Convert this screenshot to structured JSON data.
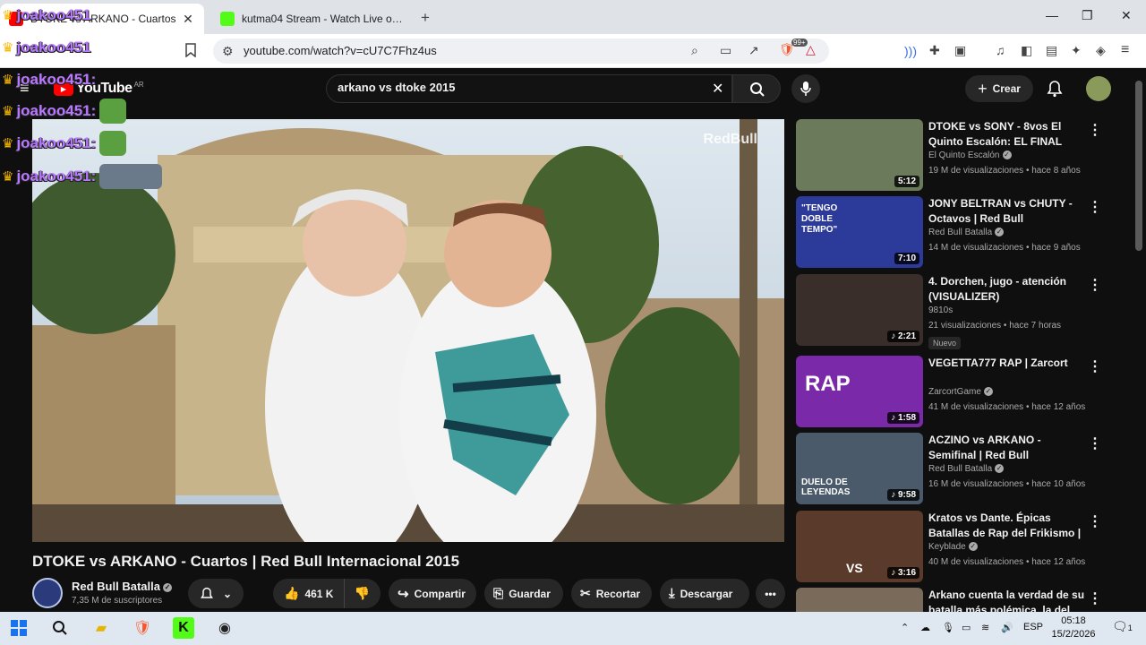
{
  "browser": {
    "tabs": [
      {
        "title": "DTOKE vs ARKANO - Cuartos",
        "active": true,
        "close": "✕"
      },
      {
        "title": "kutma04 Stream - Watch Live on Kick",
        "active": false
      }
    ],
    "new_tab": "+",
    "url": "youtube.com/watch?v=cU7C7Fhz4us",
    "window_controls": {
      "minimize": "—",
      "maximize": "❐",
      "close": "✕"
    },
    "brave_badge": "99+"
  },
  "youtube": {
    "logo": "YouTube",
    "region": "AR",
    "search_query": "arkano vs dtoke 2015",
    "create_label": "Crear",
    "video": {
      "title": "DTOKE vs ARKANO - Cuartos | Red Bull Internacional 2015",
      "watermark": "RedBull"
    },
    "channel": {
      "name": "Red Bull Batalla",
      "subscribers": "7,35 M de suscriptores"
    },
    "actions": {
      "likes": "461 K",
      "share": "Compartir",
      "save": "Guardar",
      "clip": "Recortar",
      "download": "Descargar"
    },
    "sidebar": [
      {
        "title": "DTOKE vs SONY - 8vos El Quinto Escalón: EL FINAL",
        "channel": "El Quinto Escalón",
        "verified": true,
        "meta": "19 M de visualizaciones • hace 8 años",
        "duration": "5:12",
        "thumb": "#6a7a5a"
      },
      {
        "title": "JONY BELTRAN vs CHUTY - Octavos | Red Bull Internacion...",
        "channel": "Red Bull Batalla",
        "verified": true,
        "meta": "14 M de visualizaciones • hace 9 años",
        "duration": "7:10",
        "thumb": "#2c3a9a",
        "overlay": "\"TENGO DOBLE TEMPO\""
      },
      {
        "title": "4. Dorchen, jugo - atención (VISUALIZER)",
        "channel": "9810s",
        "verified": false,
        "meta": "21 visualizaciones • hace 7 horas",
        "duration": "2:21",
        "thumb": "#3a2e2a",
        "badge": "Nuevo"
      },
      {
        "title": "VEGETTA777 RAP | Zarcort",
        "channel": "ZarcortGame",
        "verified": true,
        "meta": "41 M de visualizaciones • hace 12 años",
        "duration": "1:58",
        "thumb": "#7a2aa8",
        "overlay": "RAP"
      },
      {
        "title": "ACZINO vs ARKANO - Semifinal | Red Bull Internacional 2015",
        "channel": "Red Bull Batalla",
        "verified": true,
        "meta": "16 M de visualizaciones • hace 10 años",
        "duration": "9:58",
        "thumb": "#4a5a6a",
        "overlay": "DUELO DE LEYENDAS"
      },
      {
        "title": "Kratos vs Dante. Épicas Batallas de Rap del Frikismo | Keyblade",
        "channel": "Keyblade",
        "verified": true,
        "meta": "40 M de visualizaciones • hace 12 años",
        "duration": "3:16",
        "thumb": "#5a3a2a",
        "overlay": "VS"
      },
      {
        "title": "Arkano cuenta la verdad de su batalla más polémica. la del",
        "channel": "",
        "verified": false,
        "meta": "",
        "duration": "",
        "thumb": "#7a6a5a"
      }
    ]
  },
  "chat_overlay": {
    "username": "joakoo451",
    "lines": [
      {
        "user": "joakoo451",
        "suffix": "",
        "emote": ""
      },
      {
        "user": "joakoo451",
        "suffix": "",
        "emote": ""
      },
      {
        "user": "joakoo451",
        "suffix": ":",
        "emote": ""
      },
      {
        "user": "joakoo451",
        "suffix": ":",
        "emote": "#5aa040"
      },
      {
        "user": "joakoo451",
        "suffix": ":",
        "emote": "#5aa040"
      },
      {
        "user": "joakoo451",
        "suffix": ":",
        "emote": "#6a7a8a"
      }
    ]
  },
  "taskbar": {
    "language": "ESP",
    "time": "05:18",
    "date": "15/2/2026",
    "notifications": "1"
  }
}
